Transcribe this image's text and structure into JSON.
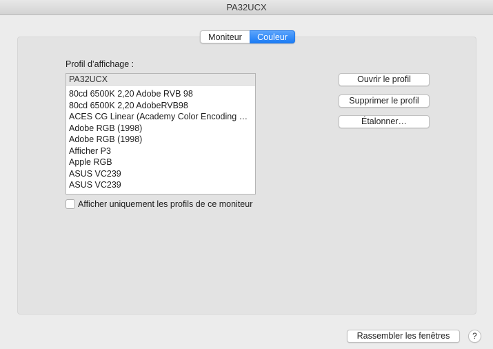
{
  "window": {
    "title": "PA32UCX"
  },
  "tabs": [
    {
      "label": "Moniteur",
      "active": false
    },
    {
      "label": "Couleur",
      "active": true
    }
  ],
  "profile": {
    "label": "Profil d’affichage :",
    "selected": "PA32UCX",
    "items": [
      "80cd 6500K 2,20 Adobe RVB 98",
      "80cd 6500K 2,20 AdobeRVB98",
      "ACES CG Linear (Academy Color Encoding Sy…",
      "Adobe RGB (1998)",
      "Adobe RGB (1998)",
      "Afficher P3",
      "Apple RGB",
      "ASUS VC239",
      "ASUS VC239"
    ]
  },
  "checkbox": {
    "label": "Afficher uniquement les profils de ce moniteur",
    "checked": false
  },
  "buttons": {
    "open": "Ouvrir le profil",
    "delete": "Supprimer le profil",
    "calibrate": "Étalonner…",
    "gather": "Rassembler les fenêtres",
    "help": "?"
  },
  "colors": {
    "accent": "#1c7cf5",
    "panel": "#e3e3e3",
    "window": "#ececec"
  }
}
